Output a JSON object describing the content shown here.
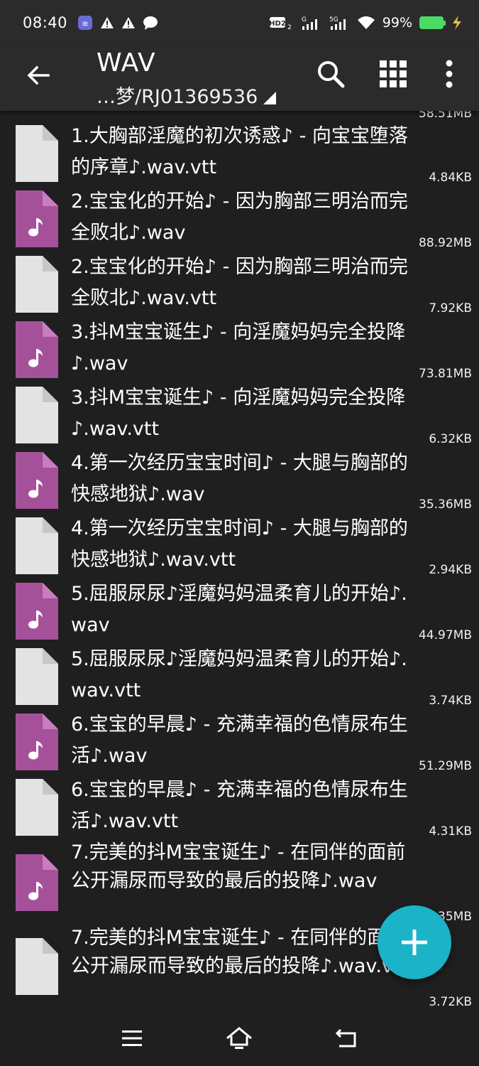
{
  "status_bar": {
    "time": "08:40",
    "battery_percent": "99%",
    "network_labels": [
      "HD2",
      "G",
      "5G"
    ],
    "icons": [
      "app-notification-icon",
      "warning-icon",
      "warning-icon",
      "chat-bubble-icon",
      "hd-icon",
      "signal-icon",
      "signal-5g-icon",
      "wifi-icon",
      "battery-icon",
      "charging-icon"
    ]
  },
  "app_bar": {
    "title": "WAV",
    "path": "…梦/RJ01369536"
  },
  "colors": {
    "audio_icon": "#a4519a",
    "document_icon": "#e3e3e3",
    "fab": "#1ab3c8",
    "background": "#1f1f1f",
    "bars": "#2b2b2b"
  },
  "files": {
    "partial_size": "58.51MB",
    "items": [
      {
        "name": "1.大胸部淫魔的初次诱惑♪ - 向宝宝堕落的序章♪.wav.vtt",
        "size": "4.84KB",
        "type": "document"
      },
      {
        "name": "2.宝宝化的开始♪ - 因为胸部三明治而完全败北♪.wav",
        "size": "88.92MB",
        "type": "audio"
      },
      {
        "name": "2.宝宝化的开始♪ - 因为胸部三明治而完全败北♪.wav.vtt",
        "size": "7.92KB",
        "type": "document"
      },
      {
        "name": "3.抖M宝宝诞生♪ - 向淫魔妈妈完全投降♪.wav",
        "size": "73.81MB",
        "type": "audio"
      },
      {
        "name": "3.抖M宝宝诞生♪ - 向淫魔妈妈完全投降♪.wav.vtt",
        "size": "6.32KB",
        "type": "document"
      },
      {
        "name": "4.第一次经历宝宝时间♪ - 大腿与胸部的快感地狱♪.wav",
        "size": "35.36MB",
        "type": "audio"
      },
      {
        "name": "4.第一次经历宝宝时间♪ - 大腿与胸部的快感地狱♪.wav.vtt",
        "size": "2.94KB",
        "type": "document"
      },
      {
        "name": "5.屈服尿尿♪淫魔妈妈温柔育儿的开始♪.wav",
        "size": "44.97MB",
        "type": "audio"
      },
      {
        "name": "5.屈服尿尿♪淫魔妈妈温柔育儿的开始♪.wav.vtt",
        "size": "3.74KB",
        "type": "document"
      },
      {
        "name": "6.宝宝的早晨♪ - 充满幸福的色情尿布生活♪.wav",
        "size": "51.29MB",
        "type": "audio"
      },
      {
        "name": "6.宝宝的早晨♪ - 充满幸福的色情尿布生活♪.wav.vtt",
        "size": "4.31KB",
        "type": "document"
      },
      {
        "name": "7.完美的抖M宝宝诞生♪ - 在同伴的面前公开漏尿而导致的最后的投降♪.wav",
        "size": "65.35MB",
        "type": "audio"
      },
      {
        "name": "7.完美的抖M宝宝诞生♪ - 在同伴的面前公开漏尿而导致的最后的投降♪.wav.vtt",
        "size": "3.72KB",
        "type": "document"
      }
    ]
  }
}
